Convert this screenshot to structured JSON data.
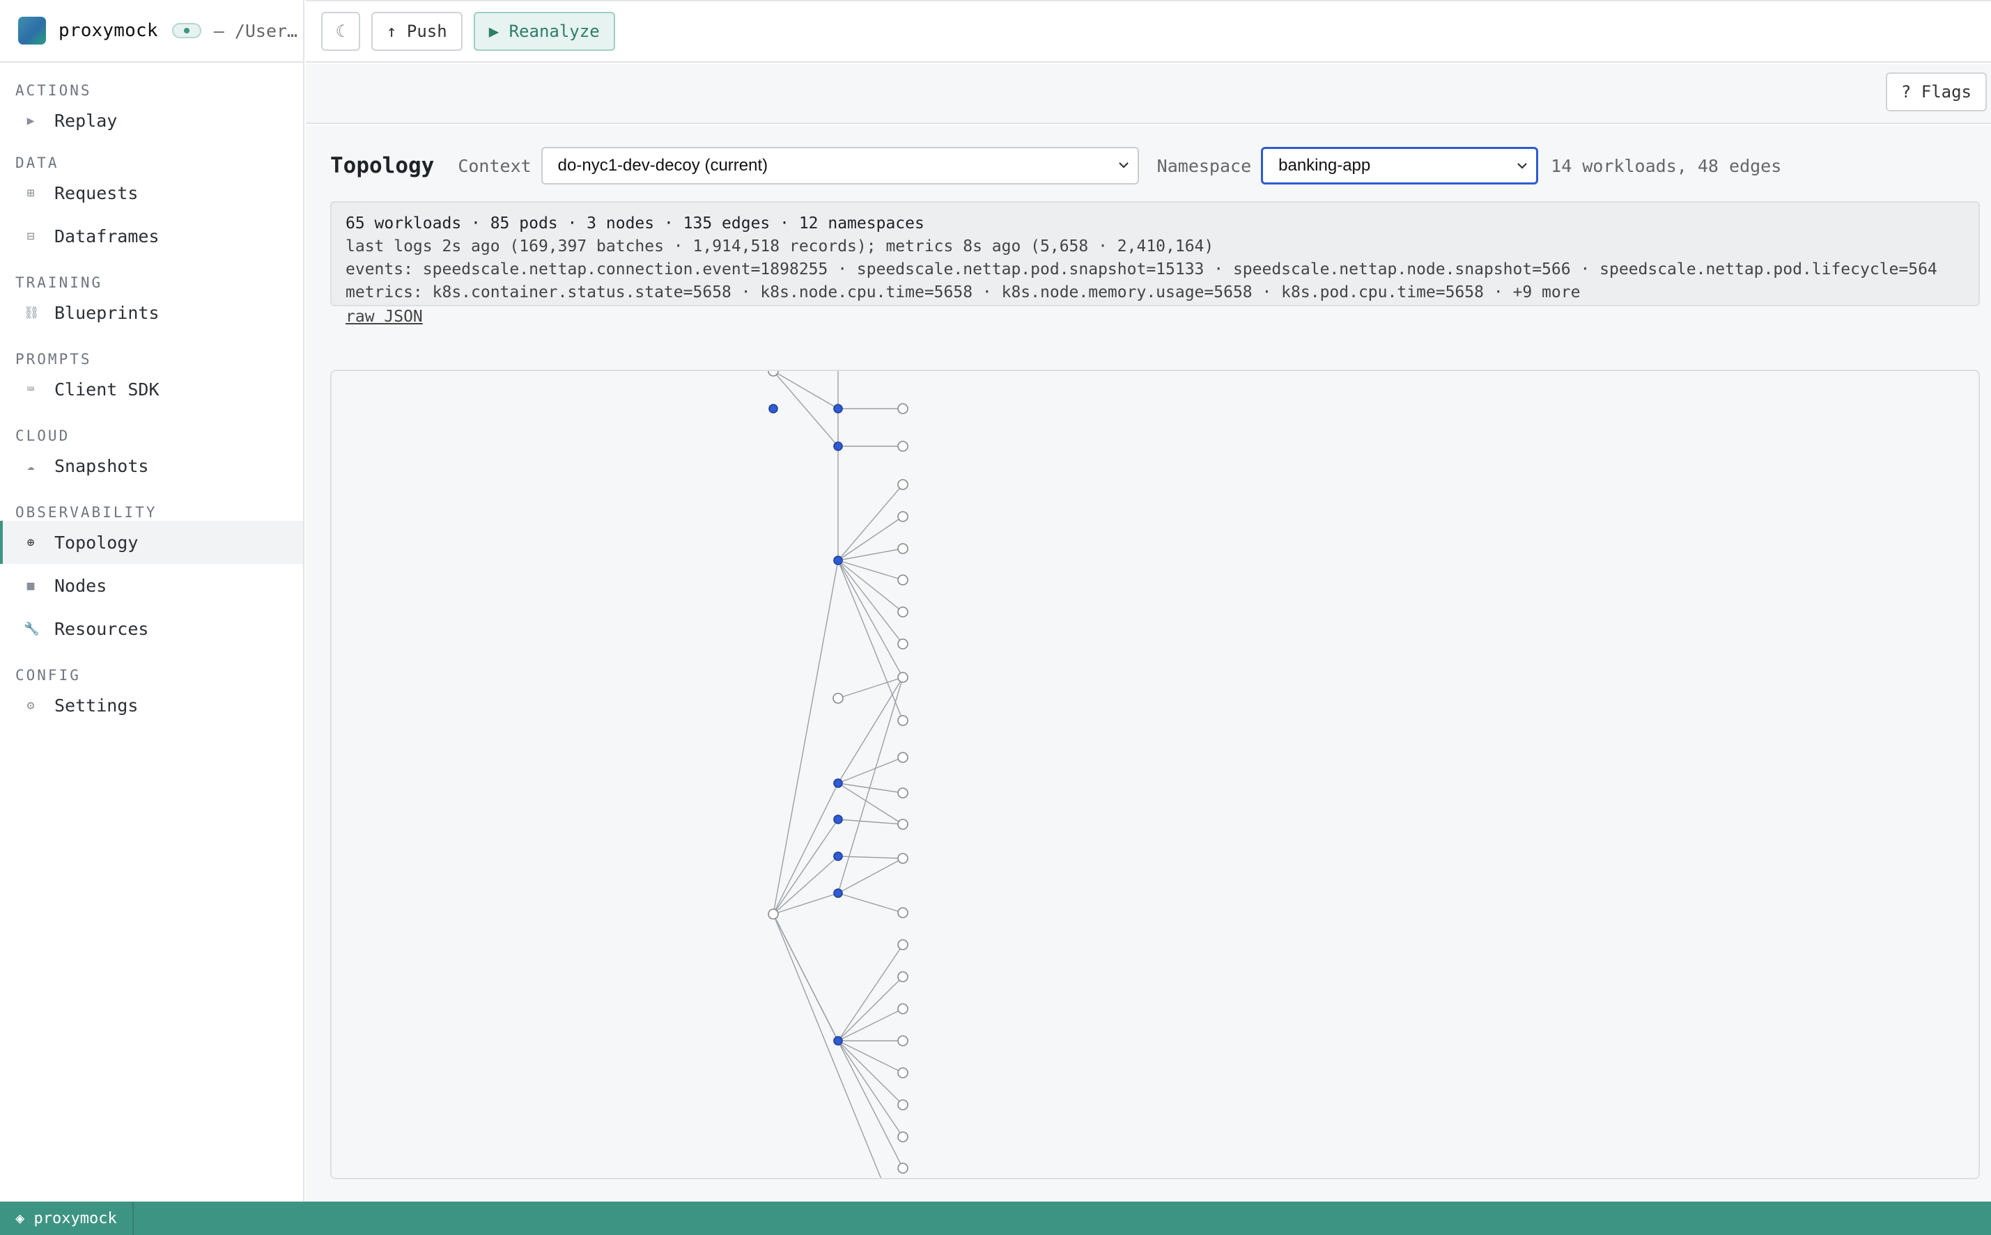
{
  "app": {
    "name": "proxymock",
    "path": "– /User…"
  },
  "sidebar": {
    "sections": [
      {
        "title": "ACTIONS",
        "items": [
          {
            "label": "Replay",
            "icon": "play-icon",
            "glyph": "▶"
          }
        ]
      },
      {
        "title": "DATA",
        "items": [
          {
            "label": "Requests",
            "icon": "grid-icon",
            "glyph": "⊞"
          },
          {
            "label": "Dataframes",
            "icon": "table-icon",
            "glyph": "⊟"
          }
        ]
      },
      {
        "title": "TRAINING",
        "items": [
          {
            "label": "Blueprints",
            "icon": "link-icon",
            "glyph": "⛓"
          }
        ]
      },
      {
        "title": "PROMPTS",
        "items": [
          {
            "label": "Client SDK",
            "icon": "keyboard-icon",
            "glyph": "⌨"
          }
        ]
      },
      {
        "title": "CLOUD",
        "items": [
          {
            "label": "Snapshots",
            "icon": "cloud-icon",
            "glyph": "☁"
          }
        ]
      },
      {
        "title": "OBSERVABILITY",
        "items": [
          {
            "label": "Topology",
            "icon": "topology-icon",
            "glyph": "⊕"
          },
          {
            "label": "Nodes",
            "icon": "square-icon",
            "glyph": "■"
          },
          {
            "label": "Resources",
            "icon": "wrench-icon",
            "glyph": "🔧"
          }
        ]
      },
      {
        "title": "CONFIG",
        "items": [
          {
            "label": "Settings",
            "icon": "gear-icon",
            "glyph": "⚙"
          }
        ]
      }
    ],
    "active": "Topology"
  },
  "toolbar": {
    "theme_glyph": "☾",
    "push_label": "↑ Push",
    "reanalyze_label": "▶ Reanalyze",
    "flags_label": "? Flags"
  },
  "topology": {
    "title": "Topology",
    "context_label": "Context",
    "context_value": "do-nyc1-dev-decoy (current)",
    "namespace_label": "Namespace",
    "namespace_value": "banking-app",
    "counts": "14 workloads, 48 edges"
  },
  "stats": {
    "line1": "65 workloads · 85 pods · 3 nodes · 135 edges · 12 namespaces",
    "line2": "last logs 2s ago (169,397 batches · 1,914,518 records); metrics 8s ago (5,658 · 2,410,164)",
    "line3": "events: speedscale.nettap.connection.event=1898255 · speedscale.nettap.pod.snapshot=15133 · speedscale.nettap.node.snapshot=566 · speedscale.nettap.pod.lifecycle=564",
    "line4": "metrics: k8s.container.status.state=5658 · k8s.node.cpu.time=5658 · k8s.node.memory.usage=5658 · k8s.pod.cpu.time=5658 · +9 more",
    "raw_link": "raw JSON"
  },
  "status_bar": {
    "label": "◈ proxymock"
  },
  "colors": {
    "accent": "#3e9483",
    "workload": "#2f5bd3",
    "edge": "#9aa0a6"
  }
}
